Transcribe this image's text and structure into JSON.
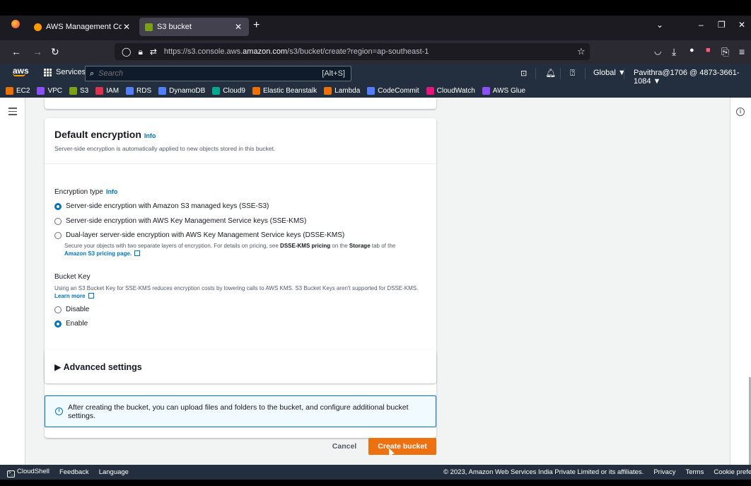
{
  "browser": {
    "tabs": [
      {
        "label": "AWS Management Console",
        "favicon_color": "#ff9900"
      },
      {
        "label": "S3 bucket",
        "favicon_color": "#7aa116"
      }
    ],
    "url_domain": "https://s3.console.aws.",
    "url_host": "amazon.com",
    "url_path": "/s3/bucket/create?region=ap-southeast-1"
  },
  "aws": {
    "logo": "aws",
    "services_label": "Services",
    "search_placeholder": "Search",
    "search_hint": "[Alt+S]",
    "region": "Global ▼",
    "account": "Pavithra@1706 @ 4873-3661-1084 ▼"
  },
  "favorites": [
    {
      "label": "EC2",
      "color": "#ed7100"
    },
    {
      "label": "VPC",
      "color": "#8c4fff"
    },
    {
      "label": "S3",
      "color": "#7aa116"
    },
    {
      "label": "IAM",
      "color": "#dd344c"
    },
    {
      "label": "RDS",
      "color": "#527fff"
    },
    {
      "label": "DynamoDB",
      "color": "#527fff"
    },
    {
      "label": "Cloud9",
      "color": "#01a88d"
    },
    {
      "label": "Elastic Beanstalk",
      "color": "#ed7100"
    },
    {
      "label": "Lambda",
      "color": "#ed7100"
    },
    {
      "label": "CodeCommit",
      "color": "#527fff"
    },
    {
      "label": "CloudWatch",
      "color": "#e7157b"
    },
    {
      "label": "AWS Glue",
      "color": "#8c4fff"
    }
  ],
  "encryption": {
    "title": "Default encryption",
    "info": "Info",
    "description": "Server-side encryption is automatically applied to new objects stored in this bucket.",
    "type_label": "Encryption type",
    "type_info": "Info",
    "options": [
      {
        "label": "Server-side encryption with Amazon S3 managed keys (SSE-S3)",
        "selected": true
      },
      {
        "label": "Server-side encryption with AWS Key Management Service keys (SSE-KMS)",
        "selected": false
      },
      {
        "label": "Dual-layer server-side encryption with AWS Key Management Service keys (DSSE-KMS)",
        "selected": false
      }
    ],
    "dsse_note_1": "Secure your objects with two separate layers of encryption. For details on pricing, see ",
    "dsse_note_bold_1": "DSSE-KMS pricing",
    "dsse_note_2": " on the ",
    "dsse_note_bold_2": "Storage",
    "dsse_note_3": " tab of the",
    "dsse_note_link": "Amazon S3 pricing page.",
    "bucket_key_label": "Bucket Key",
    "bucket_key_desc": "Using an S3 Bucket Key for SSE-KMS reduces encryption costs by lowering calls to AWS KMS. S3 Bucket Keys aren't supported for DSSE-KMS.",
    "bucket_key_link": "Learn more",
    "bucket_key_options": [
      {
        "label": "Disable",
        "selected": false
      },
      {
        "label": "Enable",
        "selected": true
      }
    ]
  },
  "advanced": {
    "title": "Advanced settings"
  },
  "alert": {
    "text": "After creating the bucket, you can upload files and folders to the bucket, and configure additional bucket settings."
  },
  "actions": {
    "cancel": "Cancel",
    "create": "Create bucket"
  },
  "footer": {
    "cloudshell": "CloudShell",
    "feedback": "Feedback",
    "language": "Language",
    "copyright": "© 2023, Amazon Web Services India Private Limited or its affiliates.",
    "privacy": "Privacy",
    "terms": "Terms",
    "cookies": "Cookie preferences"
  }
}
